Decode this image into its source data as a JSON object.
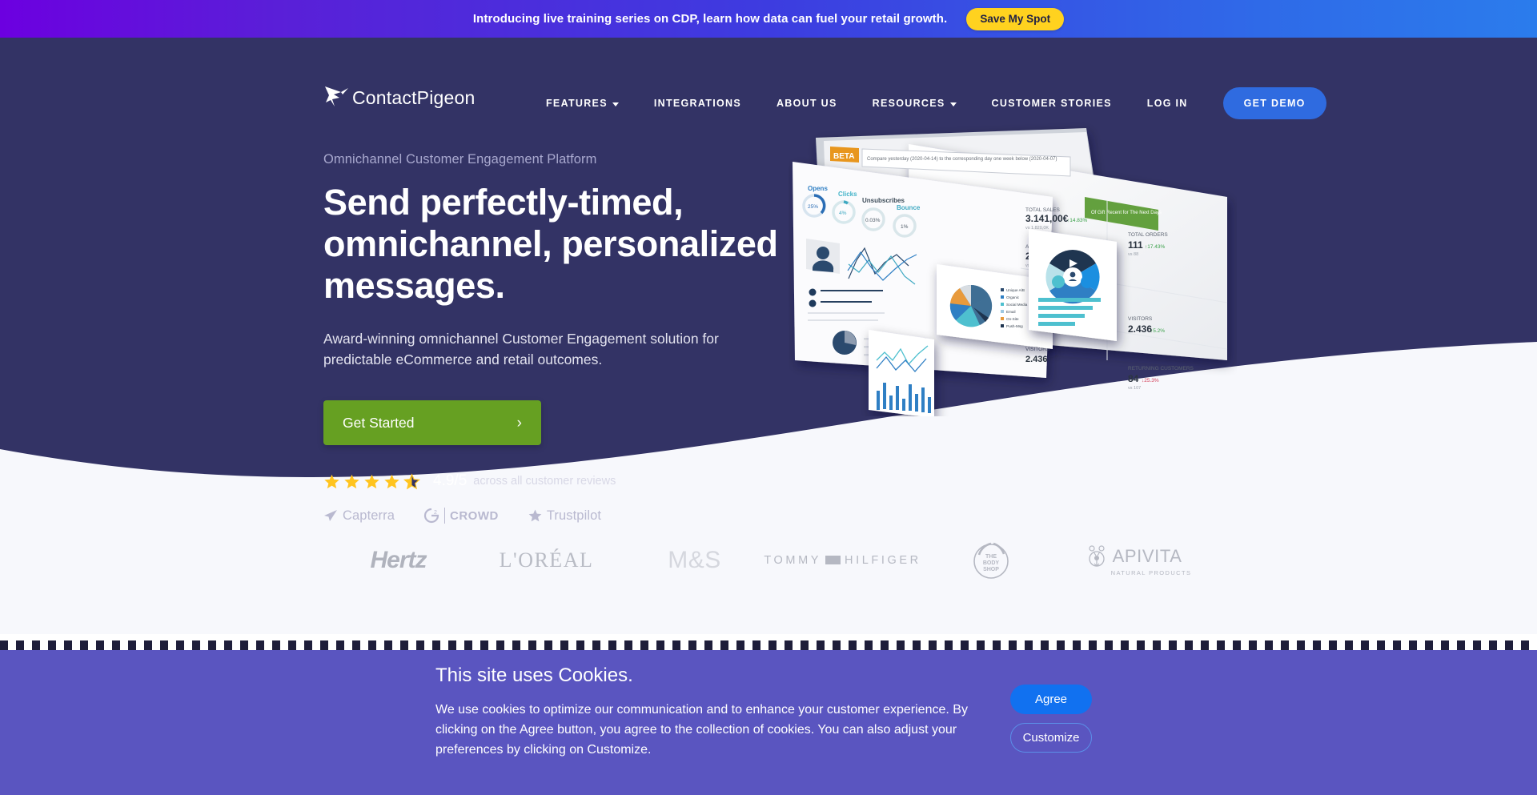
{
  "promo": {
    "text": "Introducing live training series on CDP, learn how data can fuel your retail growth.",
    "button_label": "Save My Spot",
    "button_color": "#ffd21f"
  },
  "nav": {
    "logo_text": "ContactPigeon",
    "items": [
      {
        "label": "FEATURES",
        "has_caret": true
      },
      {
        "label": "INTEGRATIONS",
        "has_caret": false
      },
      {
        "label": "ABOUT US",
        "has_caret": false
      },
      {
        "label": "RESOURCES",
        "has_caret": true
      },
      {
        "label": "CUSTOMER STORIES",
        "has_caret": false
      },
      {
        "label": "LOG IN",
        "has_caret": false
      }
    ],
    "demo_button": "GET DEMO",
    "demo_color": "#2f6be0"
  },
  "hero": {
    "eyebrow": "Omnichannel Customer Engagement Platform",
    "headline": "Send perfectly-timed, omnichannel, personalized messages.",
    "subhead": "Award-winning omnichannel Customer Engagement solution for predictable eCommerce and retail outcomes.",
    "cta_label": "Get Started",
    "cta_color": "#66a022",
    "background_color": "#333365",
    "rating": {
      "stars_filled": 4,
      "stars_half": 1,
      "score": "4.9/5",
      "caption": "across all customer reviews",
      "star_color": "#ffc41f"
    },
    "review_logos": [
      {
        "name": "Capterra",
        "icon": "capterra-arrow-icon"
      },
      {
        "name": "CROWD",
        "icon": "g2-crowd-icon"
      },
      {
        "name": "Trustpilot",
        "icon": "trustpilot-star-icon"
      }
    ]
  },
  "brands": {
    "background_color": "#f7f8fc",
    "items": [
      {
        "name": "Hertz",
        "style": "hertz"
      },
      {
        "name": "L'ORÉAL",
        "style": "loreal"
      },
      {
        "name": "M&S",
        "style": "ms"
      },
      {
        "name": "TOMMY HILFIGER",
        "style": "tommy"
      },
      {
        "name": "THE BODY SHOP",
        "style": "bodyshop"
      },
      {
        "name": "APIVITA",
        "sub": "NATURAL PRODUCTS",
        "style": "apivita"
      }
    ]
  },
  "cookie": {
    "title": "This site uses Cookies.",
    "body": "We use cookies to optimize our communication and to enhance your customer experience. By clicking on the Agree button, you agree to the collection of cookies. You can also adjust your preferences by clicking on Customize.",
    "agree_label": "Agree",
    "customize_label": "Customize",
    "background_color": "#5a55c0",
    "agree_color": "#1171f0"
  }
}
